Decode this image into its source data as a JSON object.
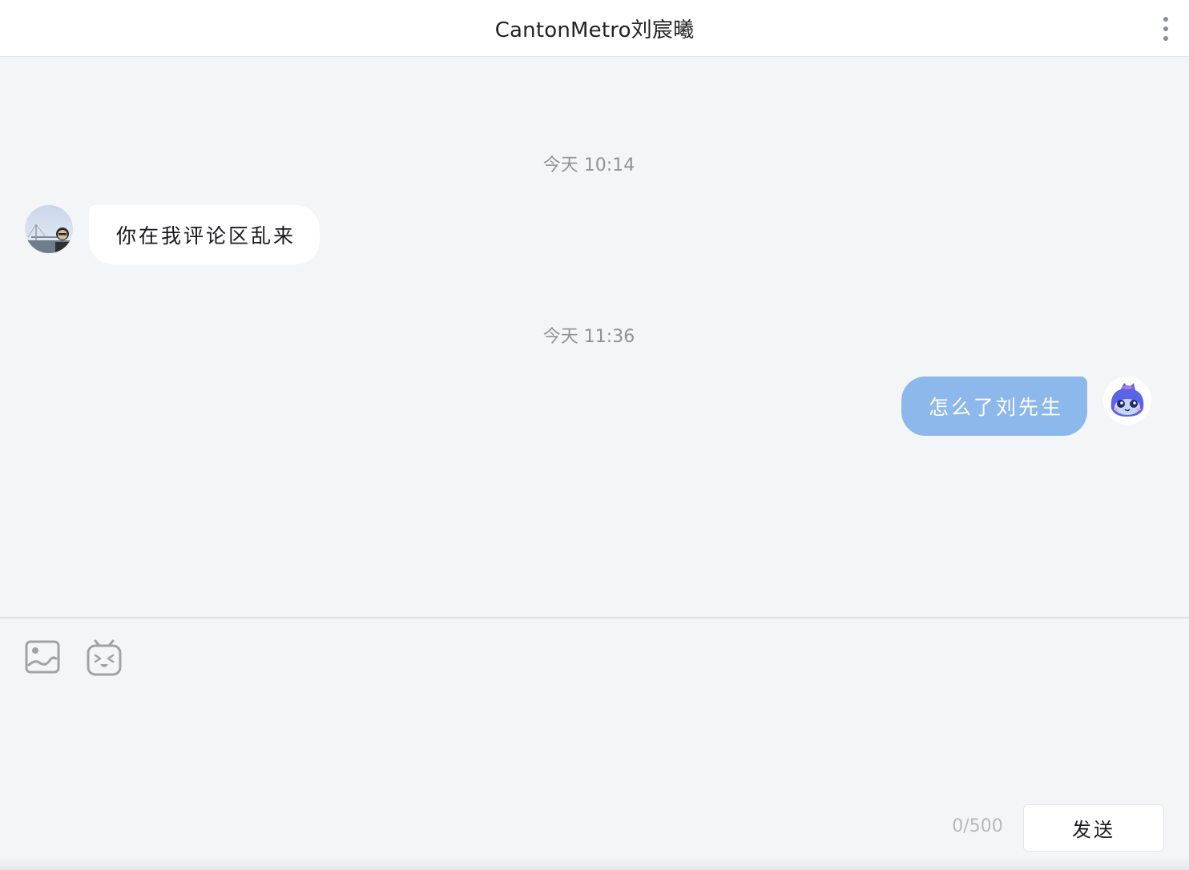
{
  "header": {
    "title": "CantonMetro刘宸曦",
    "more_icon": "more-vertical-icon"
  },
  "messages": [
    {
      "timestamp": "今天 10:14",
      "sender": "other",
      "text": "你在我评论区乱来"
    },
    {
      "timestamp": "今天 11:36",
      "sender": "self",
      "text": "怎么了刘先生"
    }
  ],
  "composer": {
    "tools": [
      "image-icon",
      "emoji-icon"
    ],
    "char_count": "0/500",
    "send_label": "发送"
  },
  "colors": {
    "self_bubble": "#8cb8ec",
    "other_bubble": "#ffffff",
    "background": "#f4f5f7"
  }
}
